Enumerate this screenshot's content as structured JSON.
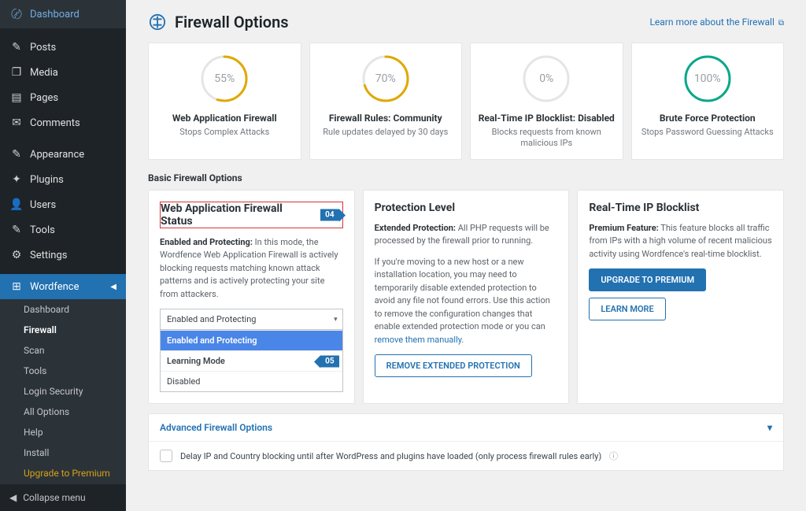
{
  "sidebar": {
    "items": [
      {
        "icon": "〄",
        "label": "Dashboard"
      },
      {
        "icon": "✎",
        "label": "Posts"
      },
      {
        "icon": "❐",
        "label": "Media"
      },
      {
        "icon": "▤",
        "label": "Pages"
      },
      {
        "icon": "✉",
        "label": "Comments"
      },
      {
        "icon": "✎",
        "label": "Appearance"
      },
      {
        "icon": "✦",
        "label": "Plugins"
      },
      {
        "icon": "👤",
        "label": "Users"
      },
      {
        "icon": "✎",
        "label": "Tools"
      },
      {
        "icon": "⚙",
        "label": "Settings"
      }
    ],
    "wordfence": {
      "label": "Wordfence",
      "icon": "⊞"
    },
    "wfsub": [
      "Dashboard",
      "Firewall",
      "Scan",
      "Tools",
      "Login Security",
      "All Options",
      "Help",
      "Install"
    ],
    "premium": "Upgrade to Premium",
    "collapse": "Collapse menu"
  },
  "header": {
    "title": "Firewall Options",
    "link": "Learn more about the Firewall"
  },
  "stats": [
    {
      "pct": 55,
      "color": "#e0a800",
      "title": "Web Application Firewall",
      "sub": "Stops Complex Attacks"
    },
    {
      "pct": 70,
      "color": "#e0a800",
      "title": "Firewall Rules: Community",
      "sub": "Rule updates delayed by 30 days"
    },
    {
      "pct": 0,
      "color": "#c3c4c7",
      "title": "Real-Time IP Blocklist: Disabled",
      "sub": "Blocks requests from known malicious IPs"
    },
    {
      "pct": 100,
      "color": "#08a88a",
      "title": "Brute Force Protection",
      "sub": "Stops Password Guessing Attacks"
    }
  ],
  "basic": {
    "title": "Basic Firewall Options"
  },
  "waf": {
    "title": "Web Application Firewall Status",
    "tag": "04",
    "desc_b": "Enabled and Protecting:",
    "desc": " In this mode, the Wordfence Web Application Firewall is actively blocking requests matching known attack patterns and is actively protecting your site from attackers.",
    "selected": "Enabled and Protecting",
    "opts": [
      "Enabled and Protecting",
      "Learning Mode",
      "Disabled"
    ],
    "tag2": "05"
  },
  "prot": {
    "title": "Protection Level",
    "desc_b": "Extended Protection:",
    "desc": " All PHP requests will be processed by the firewall prior to running.",
    "p2": "If you're moving to a new host or a new installation location, you may need to temporarily disable extended protection to avoid any file not found errors. Use this action to remove the configuration changes that enable extended protection mode or you can ",
    "p2link": "remove them manually",
    "btn": "REMOVE EXTENDED PROTECTION"
  },
  "block": {
    "title": "Real-Time IP Blocklist",
    "desc_b": "Premium Feature:",
    "desc": " This feature blocks all traffic from IPs with a high volume of recent malicious activity using Wordfence's real-time blocklist.",
    "btn1": "UPGRADE TO PREMIUM",
    "btn2": "LEARN MORE"
  },
  "adv": {
    "title": "Advanced Firewall Options",
    "opt": "Delay IP and Country blocking until after WordPress and plugins have loaded (only process firewall rules early)"
  }
}
